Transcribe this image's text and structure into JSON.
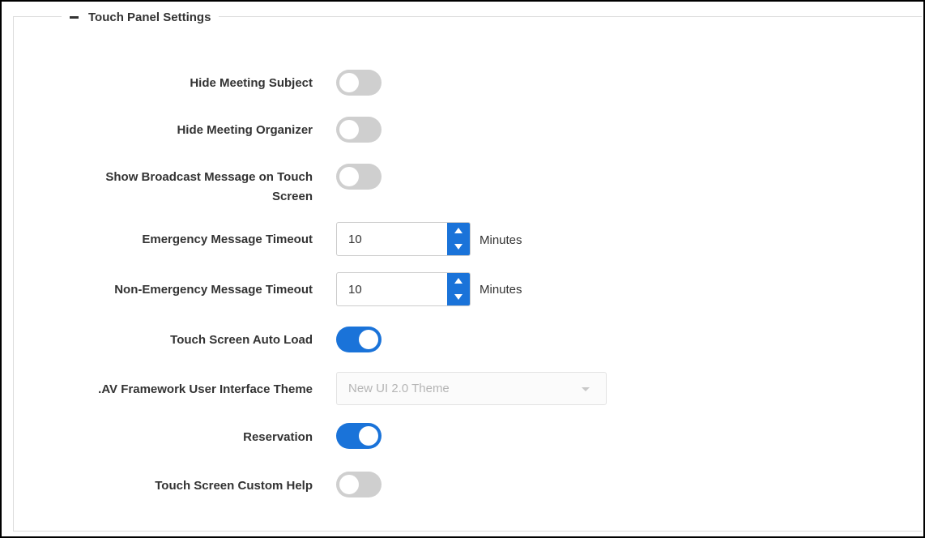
{
  "section": {
    "title": "Touch Panel Settings",
    "collapse_icon": "minus-icon"
  },
  "settings": {
    "hide_meeting_subject": {
      "label": "Hide Meeting Subject",
      "enabled": false
    },
    "hide_meeting_organizer": {
      "label": "Hide Meeting Organizer",
      "enabled": false
    },
    "show_broadcast_message": {
      "label_line1": "Show Broadcast Message on Touch",
      "label_line2": "Screen",
      "enabled": false
    },
    "emergency_timeout": {
      "label": "Emergency Message Timeout",
      "value": "10",
      "unit": "Minutes"
    },
    "non_emergency_timeout": {
      "label": "Non-Emergency Message Timeout",
      "value": "10",
      "unit": "Minutes"
    },
    "touch_screen_auto_load": {
      "label": "Touch Screen Auto Load",
      "enabled": true
    },
    "ui_theme": {
      "label": ".AV Framework User Interface Theme",
      "selected": "New UI 2.0 Theme",
      "disabled": true
    },
    "reservation": {
      "label": "Reservation",
      "enabled": true
    },
    "touch_screen_custom_help": {
      "label": "Touch Screen Custom Help",
      "enabled": false
    }
  },
  "colors": {
    "accent": "#1a73d9",
    "toggle_off": "#cfcfcf",
    "text": "#333333",
    "disabled_text": "#b5b5b5"
  }
}
